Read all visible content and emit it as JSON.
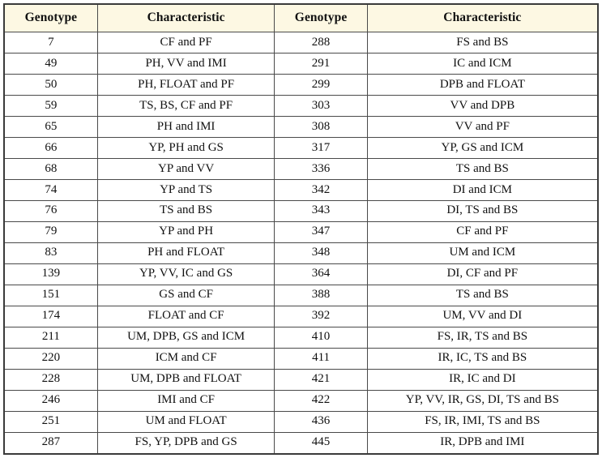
{
  "table": {
    "name": "genotype-characteristic-table",
    "header_background": "#FDF8E3",
    "border_color": "#4A4A4A",
    "outer_border_color": "#3A3A3A",
    "text_color": "#111111",
    "columns": [
      {
        "key": "genotype_left",
        "label": "Genotype"
      },
      {
        "key": "characteristic_left",
        "label": "Characteristic"
      },
      {
        "key": "genotype_right",
        "label": "Genotype"
      },
      {
        "key": "characteristic_right",
        "label": "Characteristic"
      }
    ],
    "rows": [
      {
        "genotype_left": "7",
        "characteristic_left": "CF and PF",
        "genotype_right": "288",
        "characteristic_right": "FS and BS"
      },
      {
        "genotype_left": "49",
        "characteristic_left": "PH, VV and IMI",
        "genotype_right": "291",
        "characteristic_right": "IC and ICM"
      },
      {
        "genotype_left": "50",
        "characteristic_left": "PH, FLOAT and PF",
        "genotype_right": "299",
        "characteristic_right": "DPB and FLOAT"
      },
      {
        "genotype_left": "59",
        "characteristic_left": "TS, BS, CF and PF",
        "genotype_right": "303",
        "characteristic_right": "VV and DPB"
      },
      {
        "genotype_left": "65",
        "characteristic_left": "PH and IMI",
        "genotype_right": "308",
        "characteristic_right": "VV and PF"
      },
      {
        "genotype_left": "66",
        "characteristic_left": "YP, PH and GS",
        "genotype_right": "317",
        "characteristic_right": "YP, GS and ICM"
      },
      {
        "genotype_left": "68",
        "characteristic_left": "YP and VV",
        "genotype_right": "336",
        "characteristic_right": "TS and BS"
      },
      {
        "genotype_left": "74",
        "characteristic_left": "YP and TS",
        "genotype_right": "342",
        "characteristic_right": "DI and ICM"
      },
      {
        "genotype_left": "76",
        "characteristic_left": "TS and BS",
        "genotype_right": "343",
        "characteristic_right": "DI, TS and BS"
      },
      {
        "genotype_left": "79",
        "characteristic_left": "YP and PH",
        "genotype_right": "347",
        "characteristic_right": "CF and PF"
      },
      {
        "genotype_left": "83",
        "characteristic_left": "PH and FLOAT",
        "genotype_right": "348",
        "characteristic_right": "UM and ICM"
      },
      {
        "genotype_left": "139",
        "characteristic_left": "YP, VV, IC and GS",
        "genotype_right": "364",
        "characteristic_right": "DI, CF and PF"
      },
      {
        "genotype_left": "151",
        "characteristic_left": "GS and CF",
        "genotype_right": "388",
        "characteristic_right": "TS and BS"
      },
      {
        "genotype_left": "174",
        "characteristic_left": "FLOAT and CF",
        "genotype_right": "392",
        "characteristic_right": "UM, VV and DI"
      },
      {
        "genotype_left": "211",
        "characteristic_left": "UM, DPB, GS and ICM",
        "genotype_right": "410",
        "characteristic_right": "FS, IR, TS and BS"
      },
      {
        "genotype_left": "220",
        "characteristic_left": "ICM and CF",
        "genotype_right": "411",
        "characteristic_right": "IR, IC, TS and BS"
      },
      {
        "genotype_left": "228",
        "characteristic_left": "UM, DPB and FLOAT",
        "genotype_right": "421",
        "characteristic_right": "IR, IC and DI"
      },
      {
        "genotype_left": "246",
        "characteristic_left": "IMI and CF",
        "genotype_right": "422",
        "characteristic_right": "YP, VV, IR, GS, DI, TS and BS"
      },
      {
        "genotype_left": "251",
        "characteristic_left": "UM and FLOAT",
        "genotype_right": "436",
        "characteristic_right": "FS, IR, IMI, TS and BS"
      },
      {
        "genotype_left": "287",
        "characteristic_left": "FS, YP, DPB and GS",
        "genotype_right": "445",
        "characteristic_right": "IR, DPB and IMI"
      }
    ]
  }
}
